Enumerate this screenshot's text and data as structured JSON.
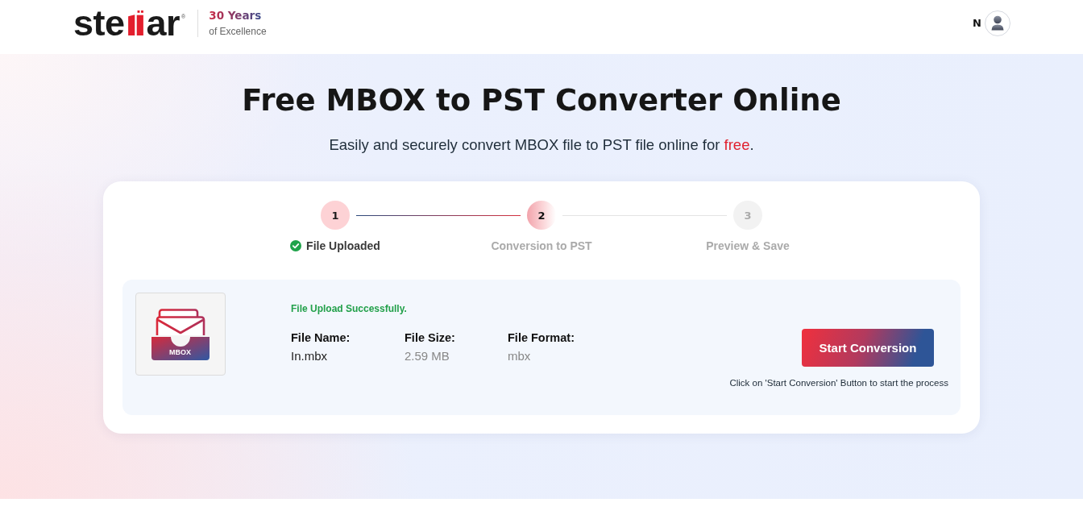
{
  "header": {
    "logo": {
      "start": "ste",
      "end": "ar",
      "mark": "®"
    },
    "tagline": {
      "title": "30 Years",
      "subtitle": "of Excellence"
    },
    "user": {
      "initial": "N"
    }
  },
  "hero": {
    "title": "Free MBOX to PST Converter Online",
    "subtitle": {
      "before": "Easily and securely convert MBOX file to PST file online for ",
      "highlight": "free",
      "after": "."
    }
  },
  "steps": [
    {
      "number": "1",
      "label": "File Uploaded",
      "completed": true,
      "selected": false
    },
    {
      "number": "2",
      "label": "Conversion to PST",
      "completed": false,
      "selected": true
    },
    {
      "number": "3",
      "label": "Preview & Save",
      "completed": false,
      "selected": false
    }
  ],
  "file_panel": {
    "thumbnail_label": "MBOX",
    "message": "File Upload Successfully.",
    "fields": [
      {
        "label": "File Name:",
        "value": "In.mbx"
      },
      {
        "label": "File Size:",
        "value": "2.59 MB"
      },
      {
        "label": "File Format:",
        "value": "mbx"
      }
    ],
    "button": "Start Conversion",
    "hint": "Click on 'Start Conversion' Button to start the process"
  }
}
